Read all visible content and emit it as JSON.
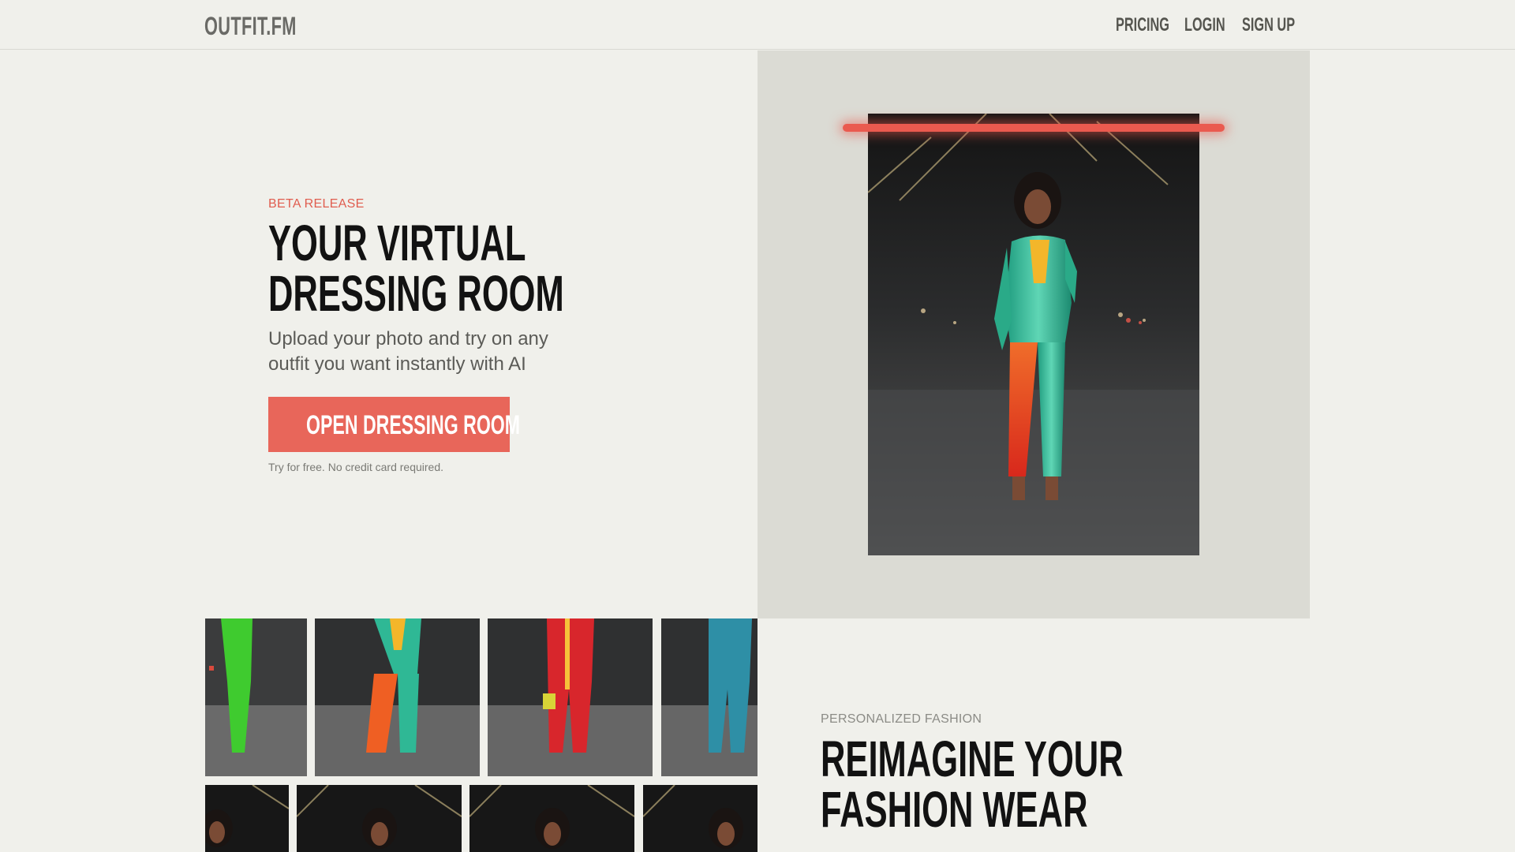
{
  "header": {
    "logo": "OUTFIT.FM",
    "nav": {
      "pricing": "PRICING",
      "login": "LOGIN",
      "signup": "SIGN UP"
    }
  },
  "hero": {
    "eyebrow": "BETA RELEASE",
    "title_line1": "YOUR VIRTUAL",
    "title_line2": "DRESSING ROOM",
    "subtitle_line1": "Upload your photo and try on any",
    "subtitle_line2": "outfit you want instantly with AI",
    "cta_label": "OPEN DRESSING ROOM",
    "note": "Try for free. No credit card required."
  },
  "gallery": {
    "row1_outfits": [
      "green jumpsuit",
      "teal jumpsuit with orange leg",
      "red jumpsuit",
      "blue jumpsuit"
    ]
  },
  "section2": {
    "eyebrow": "PERSONALIZED FASHION",
    "title_line1": "REIMAGINE YOUR",
    "title_line2": "FASHION WEAR"
  },
  "colors": {
    "accent": "#e8665a",
    "background": "#f0f0eb",
    "panel": "#dbdbd4"
  }
}
